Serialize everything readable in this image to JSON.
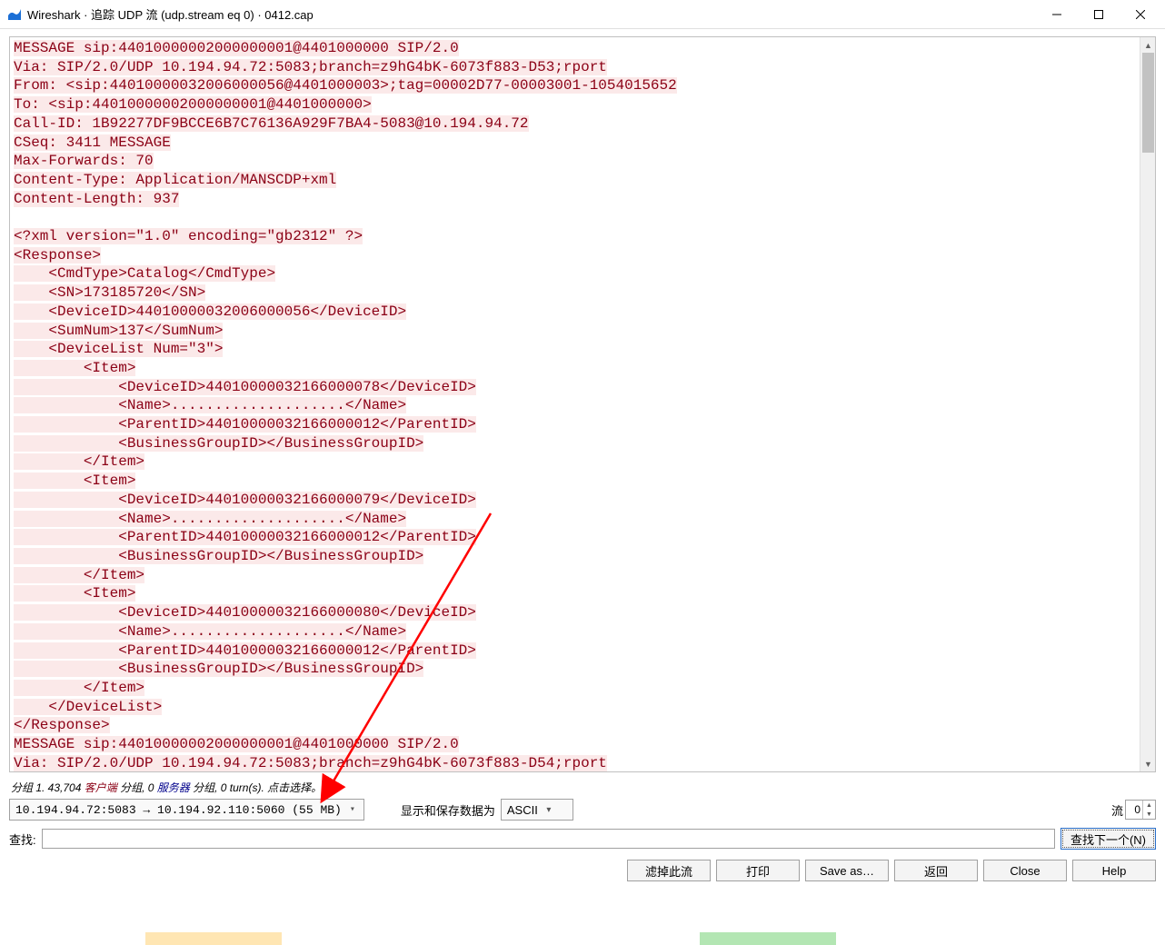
{
  "window": {
    "title": "Wireshark · 追踪 UDP 流 (udp.stream eq 0) · 0412.cap"
  },
  "stream_lines": [
    "MESSAGE sip:44010000002000000001@4401000000 SIP/2.0",
    "Via: SIP/2.0/UDP 10.194.94.72:5083;branch=z9hG4bK-6073f883-D53;rport",
    "From: <sip:44010000032006000056@4401000003>;tag=00002D77-00003001-1054015652",
    "To: <sip:44010000002000000001@4401000000>",
    "Call-ID: 1B92277DF9BCCE6B7C76136A929F7BA4-5083@10.194.94.72",
    "CSeq: 3411 MESSAGE",
    "Max-Forwards: 70",
    "Content-Type: Application/MANSCDP+xml",
    "Content-Length: 937",
    "",
    "<?xml version=\"1.0\" encoding=\"gb2312\" ?>",
    "<Response>",
    "    <CmdType>Catalog</CmdType>",
    "    <SN>173185720</SN>",
    "    <DeviceID>44010000032006000056</DeviceID>",
    "    <SumNum>137</SumNum>",
    "    <DeviceList Num=\"3\">",
    "        <Item>",
    "            <DeviceID>44010000032166000078</DeviceID>",
    "            <Name>....................</Name>",
    "            <ParentID>44010000032166000012</ParentID>",
    "            <BusinessGroupID></BusinessGroupID>",
    "        </Item>",
    "        <Item>",
    "            <DeviceID>44010000032166000079</DeviceID>",
    "            <Name>....................</Name>",
    "            <ParentID>44010000032166000012</ParentID>",
    "            <BusinessGroupID></BusinessGroupID>",
    "        </Item>",
    "        <Item>",
    "            <DeviceID>44010000032166000080</DeviceID>",
    "            <Name>....................</Name>",
    "            <ParentID>44010000032166000012</ParentID>",
    "            <BusinessGroupID></BusinessGroupID>",
    "        </Item>",
    "    </DeviceList>",
    "</Response>",
    "MESSAGE sip:44010000002000000001@4401000000 SIP/2.0",
    "Via: SIP/2.0/UDP 10.194.94.72:5083;branch=z9hG4bK-6073f883-D54;rport"
  ],
  "status": {
    "prefix": "分组 1. 43,704 ",
    "client_word": "客户端",
    "mid": " 分组, 0 ",
    "server_word": "服务器",
    "suffix": " 分组, 0 turn(s). 点击选择。"
  },
  "endpoints": {
    "combo_text": "10.194.94.72:5083 → 10.194.92.110:5060 (55 MB)",
    "display_label": "显示和保存数据为",
    "display_value": "ASCII",
    "stream_label": "流",
    "stream_value": "0"
  },
  "find": {
    "label": "查找:",
    "placeholder": "",
    "find_next": "查找下一个(N)"
  },
  "buttons": {
    "filter_out": "滤掉此流",
    "print": "打印",
    "save_as": "Save as…",
    "back": "返回",
    "close": "Close",
    "help": "Help"
  }
}
